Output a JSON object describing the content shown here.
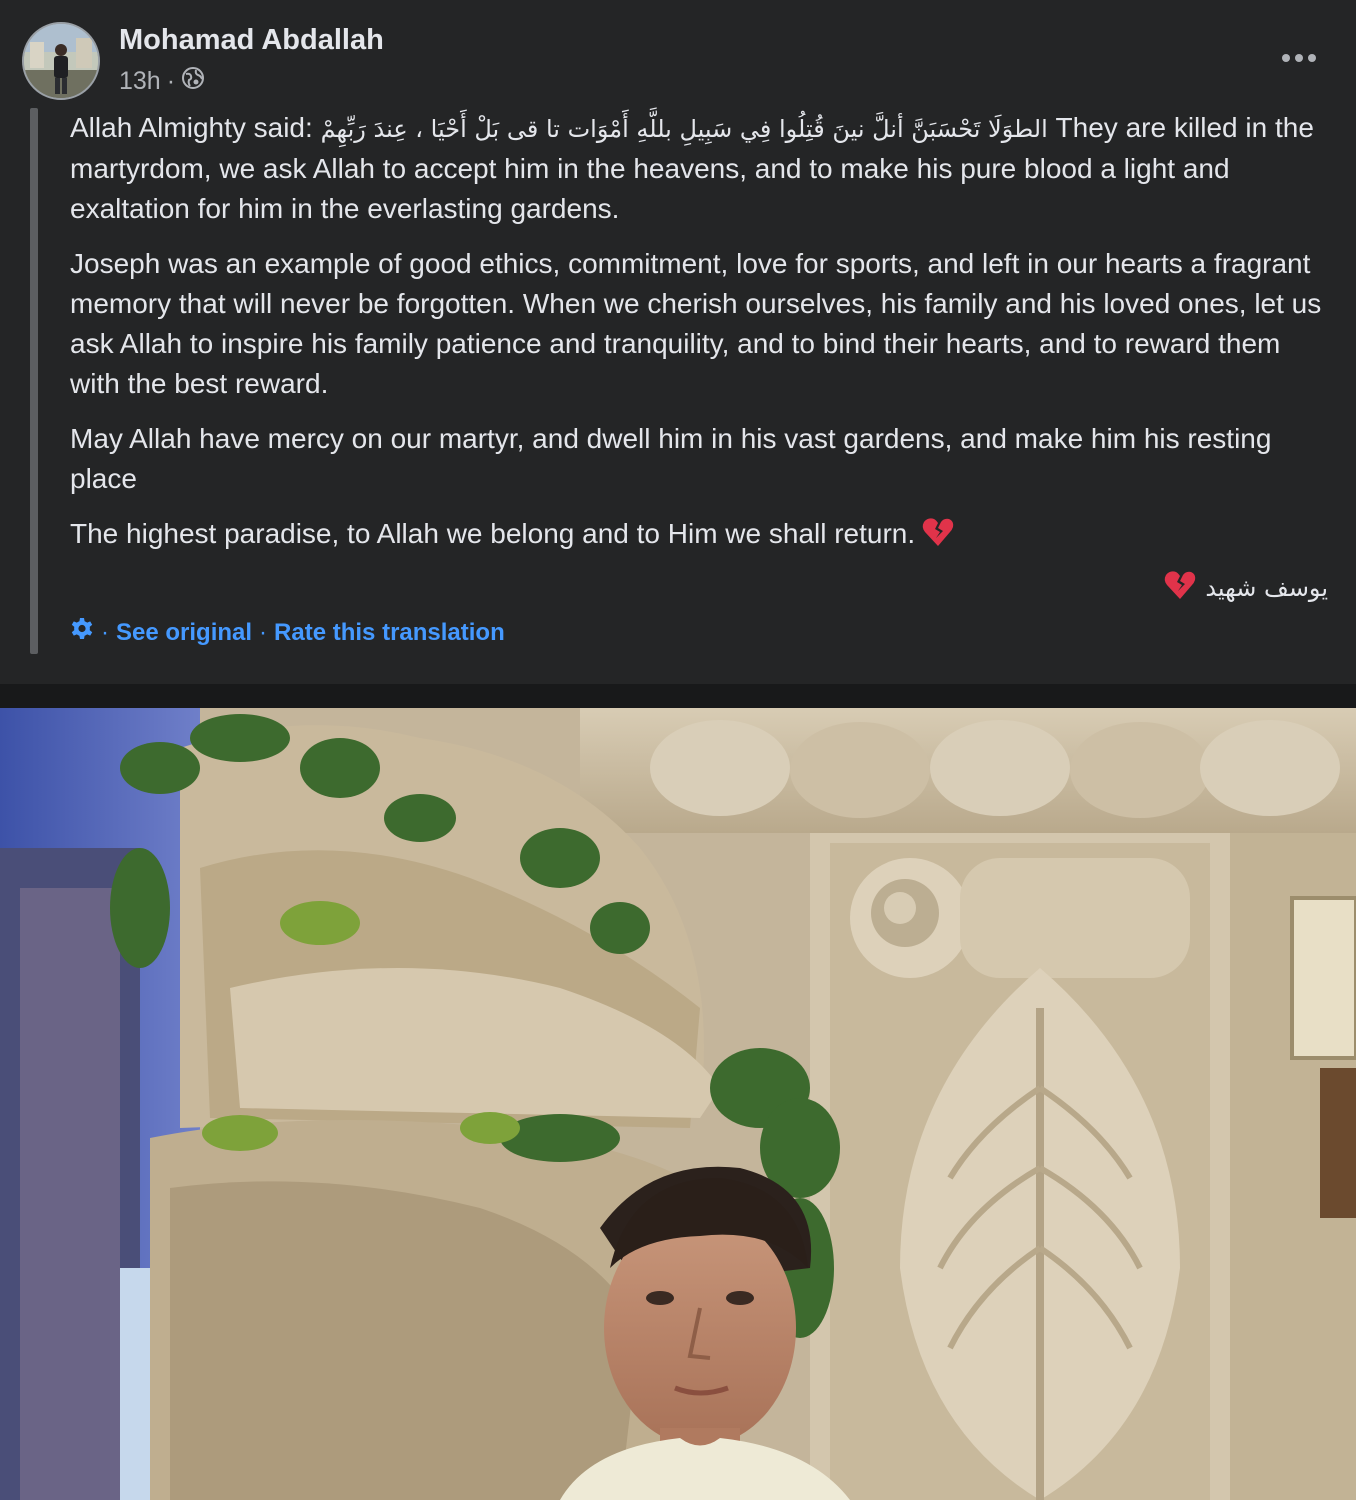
{
  "post": {
    "author": "Mohamad Abdallah",
    "time": "13h",
    "separator": "·",
    "audience_icon": "globe-icon",
    "more_icon": "more-options-icon",
    "paragraphs": {
      "p1_prefix": "Allah Almighty said: ",
      "p1_arabic": "الطوَلَا تَحْسَبَنَّ أنلَّ نينَ قُتِلُوا فِي سَبِيلِ بللَّهِ أَمْوَات تا قى بَلْ أَحْيَا ، عِندَ رَبِّهِمْ",
      "p1_rest": " They are killed in the martyrdom, we ask Allah to accept him in the heavens, and to make his pure blood a light and exaltation for him in the everlasting gardens.",
      "p2": "Joseph was an example of good ethics, commitment, love for sports, and left in our hearts a fragrant memory that will never be forgotten. When we cherish ourselves, his family and his loved ones, let us ask Allah to inspire his family patience and tranquility, and to bind their hearts, and to reward them with the best reward.",
      "p3": "May Allah have mercy on our martyr, and dwell him in his vast gardens, and make him his resting place",
      "p4": "The highest paradise, to Allah we belong and to Him we shall return."
    },
    "signature": "يوسف شهيد",
    "broken_heart_icon": "broken-heart-icon",
    "translation": {
      "settings_icon": "gear-icon",
      "separator": "·",
      "see_original": "See original",
      "rate": "Rate this translation"
    },
    "photo_alt_icon": "post-photo"
  },
  "colors": {
    "background": "#242526",
    "text": "#e4e6eb",
    "secondary_text": "#b0b3b8",
    "link": "#4599ff",
    "quote_bar": "#5c5e61"
  }
}
